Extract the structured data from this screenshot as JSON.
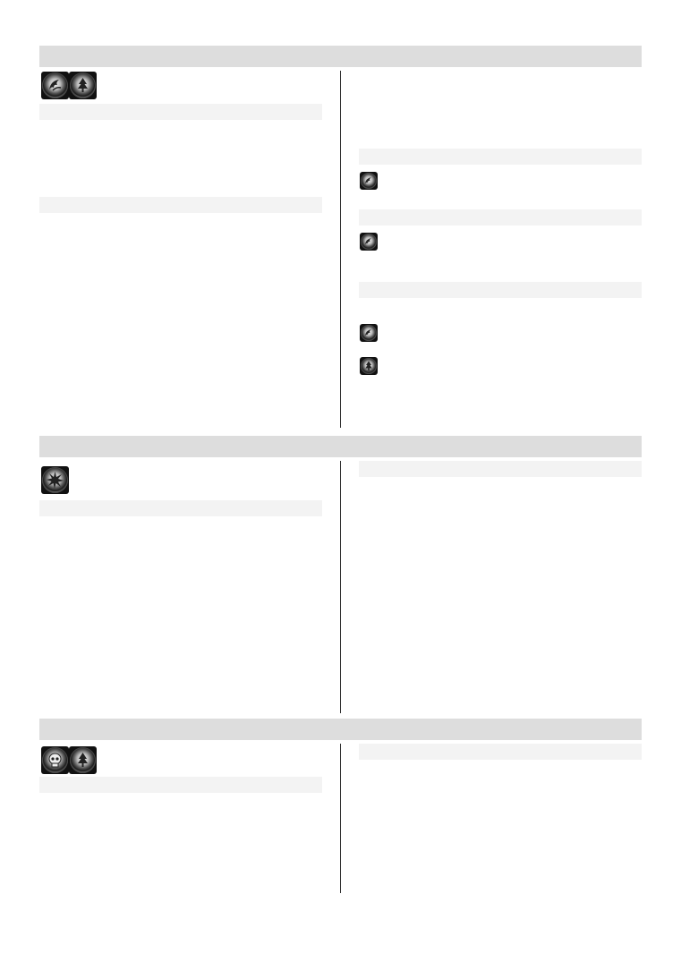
{
  "document": {
    "sections": [
      {
        "id": "section-1",
        "header": "",
        "icons": [
          "claw-icon",
          "tree-icon"
        ],
        "left_subheaders": [
          "",
          ""
        ],
        "right_subheaders": [
          "",
          "",
          ""
        ],
        "right_icons": [
          "claw-icon",
          "claw-icon",
          "claw-icon",
          "tree-icon"
        ]
      },
      {
        "id": "section-2",
        "header": "",
        "icons": [
          "burst-icon"
        ],
        "left_subheaders": [
          ""
        ],
        "right_subheaders": [
          ""
        ]
      },
      {
        "id": "section-3",
        "header": "",
        "icons": [
          "skull-icon",
          "tree-icon"
        ],
        "left_subheaders": [
          ""
        ],
        "right_subheaders": [
          ""
        ]
      }
    ]
  }
}
